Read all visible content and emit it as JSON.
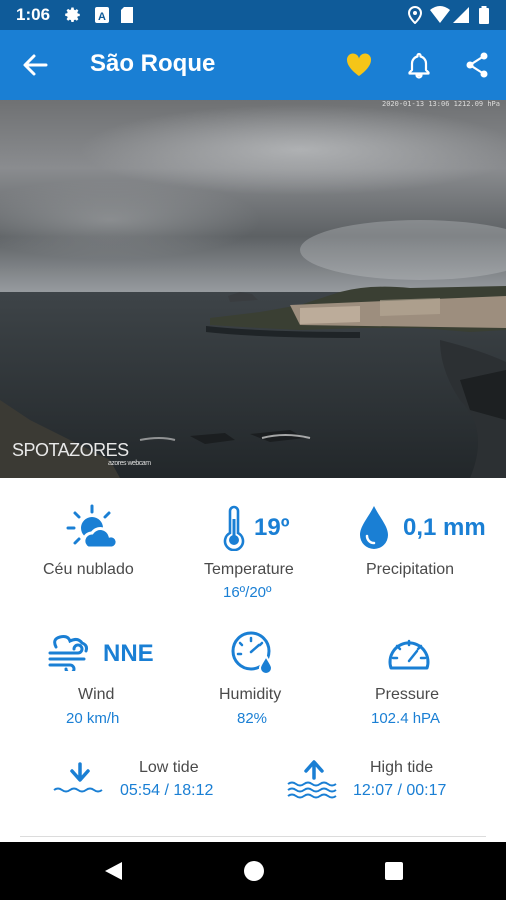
{
  "status_bar": {
    "time": "1:06"
  },
  "app_bar": {
    "title": "São Roque"
  },
  "webcam": {
    "watermark": "SPOTAZORES",
    "watermark_sub": "azores webcam",
    "timestamp": "2020-01-13 13:06  1212.09 hPa"
  },
  "weather": {
    "sky": {
      "label": "Céu nublado"
    },
    "temperature": {
      "value": "19º",
      "label": "Temperature",
      "range": "16º/20º"
    },
    "precipitation": {
      "value": "0,1 mm",
      "label": "Precipitation"
    },
    "wind": {
      "value": "NNE",
      "label": "Wind",
      "speed": "20 km/h"
    },
    "humidity": {
      "label": "Humidity",
      "value": "82%"
    },
    "pressure": {
      "label": "Pressure",
      "value": "102.4 hPA"
    }
  },
  "tides": {
    "low": {
      "label": "Low tide",
      "times": "05:54 / 18:12"
    },
    "high": {
      "label": "High tide",
      "times": "12:07 / 00:17"
    }
  },
  "colors": {
    "accent": "#1a7fd4",
    "status_bar": "#0f5b99",
    "favorite": "#f5c518"
  }
}
